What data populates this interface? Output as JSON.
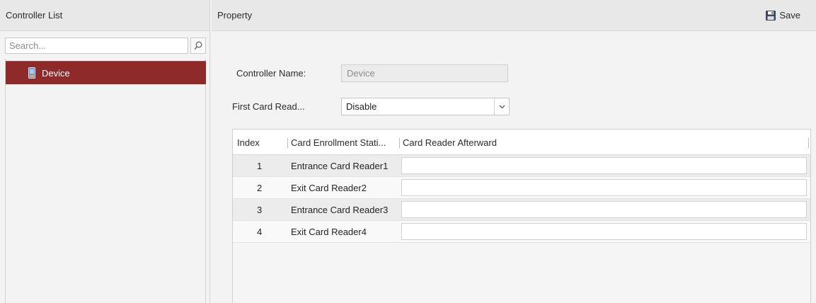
{
  "left": {
    "title": "Controller List",
    "search": {
      "placeholder": "Search...",
      "value": ""
    },
    "tree": [
      {
        "label": "Device",
        "icon": "device-icon",
        "selected": true
      }
    ]
  },
  "right": {
    "title": "Property",
    "save_label": "Save",
    "controller_name": {
      "label": "Controller Name:",
      "value": "Device"
    },
    "first_card_reader": {
      "label": "First Card Read...",
      "value": "Disable"
    }
  },
  "table": {
    "columns": [
      "Index",
      "Card Enrollment Stati...",
      "Card Reader Afterward"
    ],
    "rows": [
      {
        "index": "1",
        "station": "Entrance Card Reader1",
        "afterward": ""
      },
      {
        "index": "2",
        "station": "Exit Card Reader2",
        "afterward": ""
      },
      {
        "index": "3",
        "station": "Entrance Card Reader3",
        "afterward": ""
      },
      {
        "index": "4",
        "station": "Exit Card Reader4",
        "afterward": ""
      }
    ]
  },
  "colors": {
    "selected_row": "#8f2a2a",
    "panel_bg": "#f3f3f3",
    "header_bg": "#e8e8e8"
  }
}
